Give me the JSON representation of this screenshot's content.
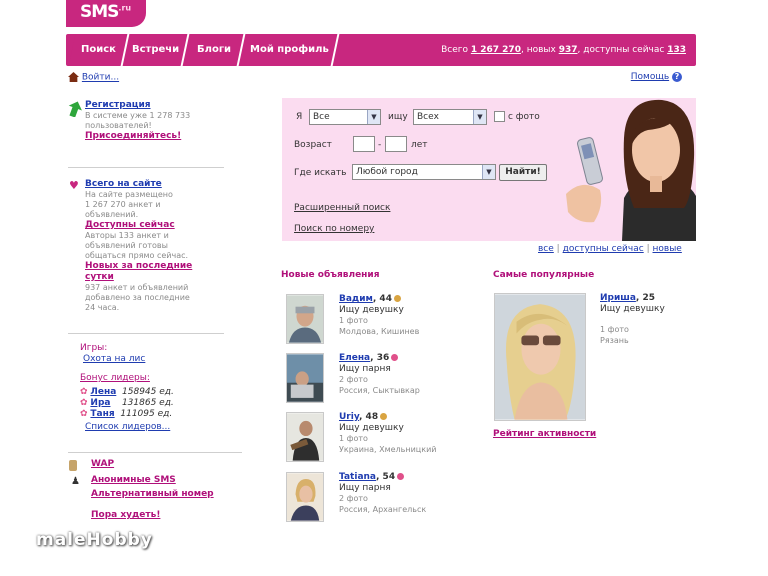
{
  "logo": {
    "text": "SMS",
    "sub": ".ru"
  },
  "nav": {
    "tabs": [
      "Поиск",
      "Встречи",
      "Блоги",
      "Мой профиль"
    ],
    "stats": {
      "total_label": "Всего",
      "total": "1 267 270",
      "new_label": ", новых",
      "new": "937",
      "online_label": ", доступны сейчас",
      "online": "133"
    }
  },
  "top": {
    "login": "Войти...",
    "help": "Помощь",
    "help_badge": "?"
  },
  "sidebar": {
    "register": {
      "title": "Регистрация",
      "line1": "В системе уже 1 278 733",
      "line2": "пользователей!",
      "join": "Присоединяйтесь!"
    },
    "all": {
      "title": "Всего на сайте",
      "l1": "На сайте размещено",
      "l2": "1 267 270 анкет и",
      "l3": "объявлений."
    },
    "online": {
      "title": "Доступны сейчас",
      "l1": "Авторы 133 анкет и",
      "l2": "объявлений готовы",
      "l3": "общаться прямо сейчас."
    },
    "recent": {
      "title1": "Новых за последние",
      "title2": "сутки",
      "l1": "937 анкет и объявлений",
      "l2": "добавлено за последние",
      "l3": "24 часа."
    },
    "games": {
      "label": "Игры:",
      "link": "Охота на лис"
    },
    "bonus": {
      "label": "Бонус лидеры:",
      "leaders": [
        {
          "name": "Лена",
          "value": "158945 ед."
        },
        {
          "name": "Ира",
          "value": "131865 ед."
        },
        {
          "name": "Таня",
          "value": "111095 ед."
        }
      ],
      "list": "Список лидеров..."
    },
    "extra": [
      "WAP",
      "Анонимные SMS",
      "Альтернативный номер",
      "Пора худеть!"
    ]
  },
  "search": {
    "ya_label": "Я",
    "ya_value": "Все",
    "ishchu_label": "ищу",
    "ishchu_value": "Всех",
    "photo_label": "с фото",
    "age_label": "Возраст",
    "age_dash": "-",
    "age_unit": "лет",
    "where_label": "Где искать",
    "where_value": "Любой город",
    "find_button": "Найти!",
    "advanced": "Расширенный поиск",
    "by_number": "Поиск по номеру"
  },
  "filters": {
    "all": "все",
    "online": "доступны сейчас",
    "new": "новые"
  },
  "new_ads": {
    "title": "Новые объявления",
    "items": [
      {
        "name": "Вадим",
        "age": ", 44",
        "seek": "Ищу девушку",
        "photos": "1 фото",
        "loc": "Молдова, Кишинев",
        "gender_color": "#d9a441"
      },
      {
        "name": "Елена",
        "age": ", 36",
        "seek": "Ищу парня",
        "photos": "2 фото",
        "loc": "Россия, Сыктывкар",
        "gender_color": "#e0508a"
      },
      {
        "name": "Uriy",
        "age": ", 48",
        "seek": "Ищу девушку",
        "photos": "1 фото",
        "loc": "Украина, Хмельницкий",
        "gender_color": "#d9a441"
      },
      {
        "name": "Tatiana",
        "age": ", 54",
        "seek": "Ищу парня",
        "photos": "2 фото",
        "loc": "Россия, Архангельск",
        "gender_color": "#e0508a"
      }
    ]
  },
  "popular": {
    "title": "Самые популярные",
    "name": "Ириша",
    "age": ", 25",
    "seek": "Ищу девушку",
    "photos": "1 фото",
    "loc": "Рязань",
    "rating": "Рейтинг активности"
  },
  "watermark": "maleHobby",
  "colors": {
    "brand": "#c8277f",
    "link": "#1f3cb0",
    "panel": "#fbdcf0"
  }
}
